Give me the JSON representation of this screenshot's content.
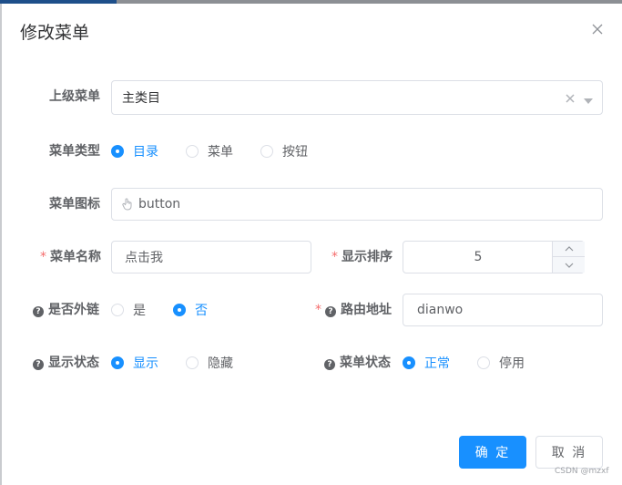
{
  "dialog": {
    "title": "修改菜单",
    "close_icon": "close-icon"
  },
  "form": {
    "parent_menu": {
      "label": "上级菜单",
      "value": "主类目",
      "clear_icon": "clear-icon",
      "arrow_icon": "chevron-down-icon"
    },
    "menu_type": {
      "label": "菜单类型",
      "options": [
        "目录",
        "菜单",
        "按钮"
      ],
      "selected": "目录"
    },
    "menu_icon": {
      "label": "菜单图标",
      "value": "button",
      "icon": "hand-pointer-icon"
    },
    "menu_name": {
      "label": "菜单名称",
      "required_mark": "*",
      "value": "点击我"
    },
    "display_order": {
      "label": "显示排序",
      "required_mark": "*",
      "value": "5",
      "up_icon": "chevron-up-icon",
      "down_icon": "chevron-down-icon"
    },
    "is_external": {
      "label": "是否外链",
      "help_icon": "question-circle-icon",
      "options": [
        "是",
        "否"
      ],
      "selected": "否"
    },
    "route_path": {
      "label": "路由地址",
      "required_mark": "*",
      "help_icon": "question-circle-icon",
      "value": "dianwo"
    },
    "visible": {
      "label": "显示状态",
      "help_icon": "question-circle-icon",
      "options": [
        "显示",
        "隐藏"
      ],
      "selected": "显示"
    },
    "status": {
      "label": "菜单状态",
      "help_icon": "question-circle-icon",
      "options": [
        "正常",
        "停用"
      ],
      "selected": "正常"
    }
  },
  "footer": {
    "confirm_label": "确 定",
    "cancel_label": "取 消"
  },
  "watermark": "CSDN @mzxf",
  "colors": {
    "primary": "#1890ff",
    "required": "#f56c6c",
    "border": "#dcdfe6",
    "text": "#606266",
    "title": "#303133"
  }
}
